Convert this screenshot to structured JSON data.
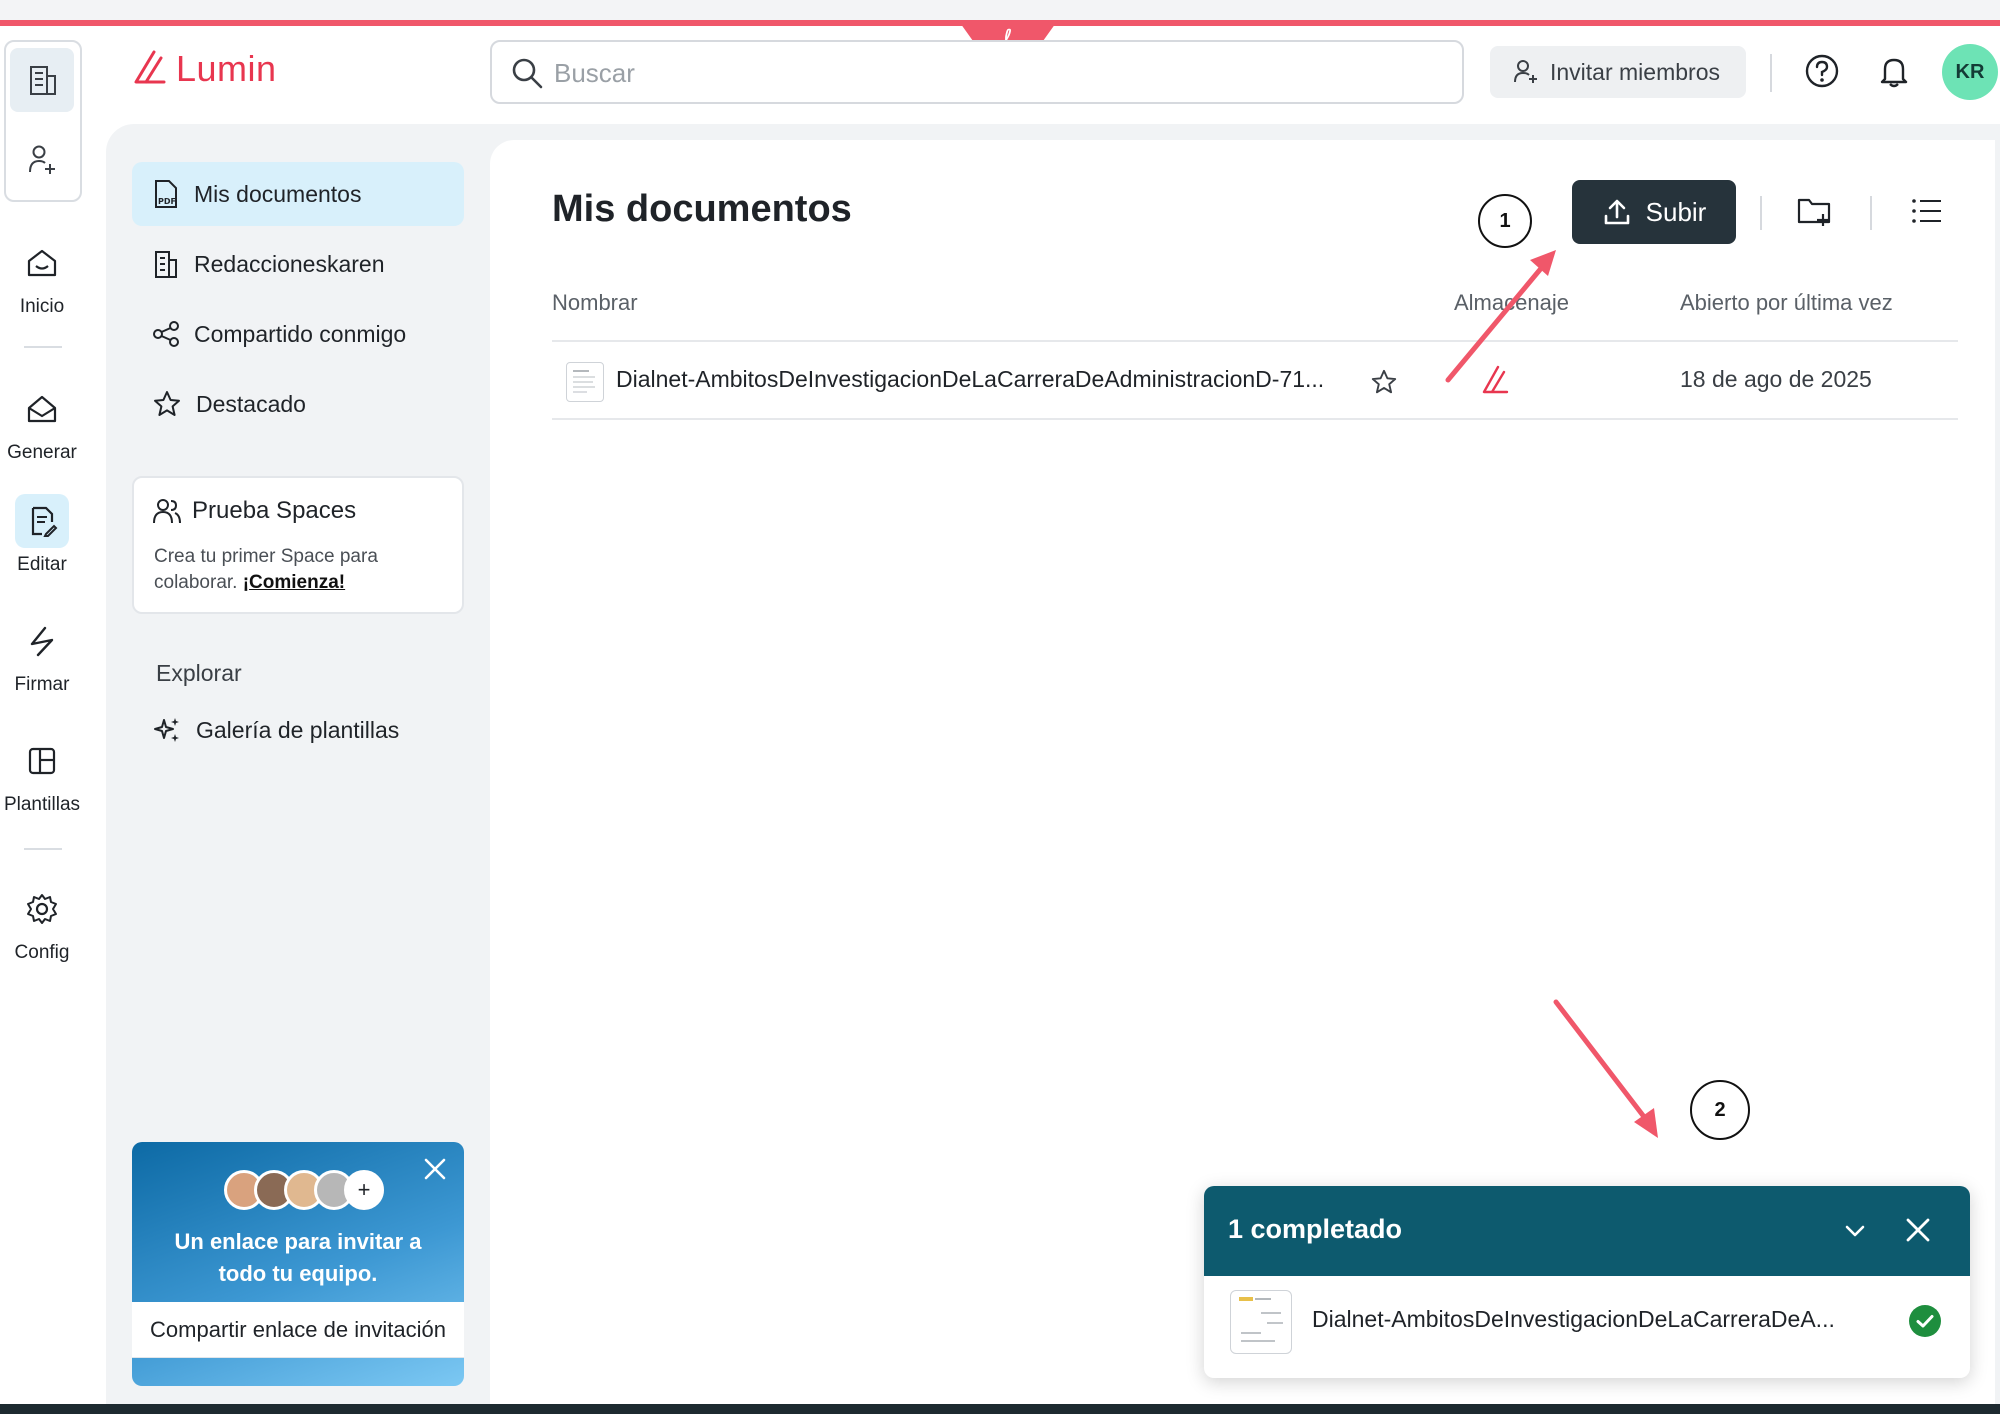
{
  "brand": {
    "name": "Lumin",
    "accent": "#e8364f"
  },
  "header": {
    "search_placeholder": "Buscar",
    "invite_label": "Invitar miembros",
    "avatar_initials": "KR"
  },
  "rail": {
    "items": [
      {
        "label": "Inicio",
        "icon": "home-icon"
      },
      {
        "label": "Generar",
        "icon": "generate-icon"
      },
      {
        "label": "Editar",
        "icon": "edit-document-icon"
      },
      {
        "label": "Firmar",
        "icon": "signature-icon"
      },
      {
        "label": "Plantillas",
        "icon": "templates-icon"
      },
      {
        "label": "Config",
        "icon": "gear-icon"
      }
    ]
  },
  "sidebar": {
    "items": [
      {
        "label": "Mis documentos"
      },
      {
        "label": "Redaccioneskaren"
      },
      {
        "label": "Compartido conmigo"
      },
      {
        "label": "Destacado"
      }
    ],
    "spaces": {
      "title": "Prueba Spaces",
      "desc": "Crea tu primer Space para colaborar.",
      "link": "¡Comienza!"
    },
    "explore_label": "Explorar",
    "gallery_label": "Galería de plantillas",
    "promo": {
      "text": "Un enlace para invitar a todo tu equipo.",
      "button": "Compartir enlace de invitación"
    }
  },
  "main": {
    "title": "Mis documentos",
    "upload_label": "Subir",
    "columns": {
      "name": "Nombrar",
      "storage": "Almacenaje",
      "opened": "Abierto por última vez"
    },
    "rows": [
      {
        "name": "Dialnet-AmbitosDeInvestigacionDeLaCarreraDeAdministracionD-71...",
        "opened": "18 de ago de 2025"
      }
    ]
  },
  "annotations": {
    "one": "1",
    "two": "2",
    "arrow_color": "#f0576a"
  },
  "toast": {
    "title": "1 completado",
    "file": "Dialnet-AmbitosDeInvestigacionDeLaCarreraDeA...",
    "status_color": "#1e8e3e"
  }
}
